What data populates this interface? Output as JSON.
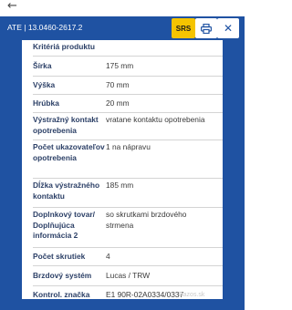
{
  "header": {
    "back_label": "←",
    "title": "ATE | 13.0460-2617.2",
    "srs_label": "SRS",
    "print_icon": "printer-icon",
    "close_label": "✕"
  },
  "panel": {
    "heading": "Kritériá produktu",
    "rows": [
      {
        "label": "Šírka",
        "value": "175 mm"
      },
      {
        "label": "Výška",
        "value": "70 mm"
      },
      {
        "label": "Hrúbka",
        "value": "20 mm"
      },
      {
        "label": "Výstražný kontakt opotrebenia",
        "value": "vratane kontaktu opotrebenia"
      },
      {
        "label": "Počet ukazovateľov opotrebenia",
        "value": "1 na nápravu"
      },
      {
        "label": "Dĺžka výstražného kontaktu",
        "value": "185 mm"
      },
      {
        "label": "Doplnkový tovar/ Doplňujúca informácia 2",
        "value": "so skrutkami brzdového strmena"
      },
      {
        "label": "Počet skrutiek",
        "value": "4"
      },
      {
        "label": "Brzdový systém",
        "value": "Lucas / TRW"
      },
      {
        "label": "Kontrol. značka",
        "value": "E1 90R-02A0334/0337"
      }
    ]
  },
  "watermark": "Bazos.sk",
  "colors": {
    "header_bg": "#1f52a2",
    "srs_bg": "#f5c400",
    "label_text": "#2b3f66"
  }
}
